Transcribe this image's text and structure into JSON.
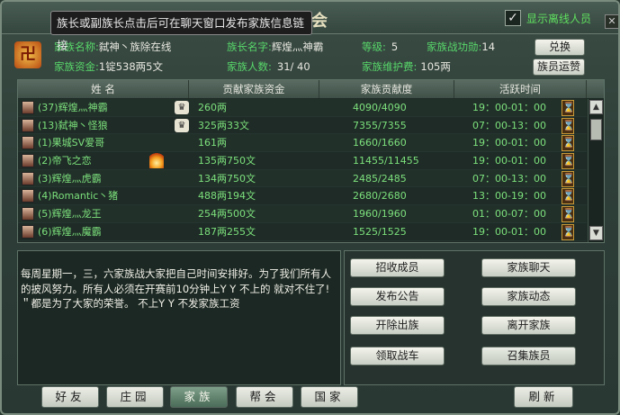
{
  "window": {
    "title": "家族会",
    "tooltip": "族长或副族长点击后可在聊天窗口发布家族信息链接"
  },
  "header": {
    "show_offline_label": "显示离线人员",
    "show_offline_checked": true,
    "close_label": "✕",
    "emblem_glyph": "卍"
  },
  "info": {
    "family_name_label": "家族名称:",
    "family_name_value": "弑神丶族除在线",
    "leader_label": "族长名字:",
    "leader_value": "辉煌灬神霸",
    "level_label": "等级:",
    "level_value": "5",
    "merit_label": "家族战功勋:",
    "merit_value": "14",
    "funds_label": "家族资金:",
    "funds_value": "1锭538两5文",
    "members_label": "家族人数:",
    "members_value": "31/ 40",
    "upkeep_label": "家族维护费:",
    "upkeep_value": "105两",
    "exchange_label": "兑换",
    "transport_label": "族员运赞"
  },
  "table": {
    "headers": [
      "姓     名",
      "贡献家族资金",
      "家族贡献度",
      "活跃时间"
    ],
    "rows": [
      {
        "name": "(37)辉煌灬神霸",
        "funds": "260两",
        "contribution": "4090/4090",
        "active": "19：00-01：00",
        "badge": "crown"
      },
      {
        "name": "(13)弑神丶怪狼",
        "funds": "325两33文",
        "contribution": "7355/7355",
        "active": "07：00-13：00",
        "badge": "crown"
      },
      {
        "name": "(1)果城SV爱哥",
        "funds": "161两",
        "contribution": "1660/1660",
        "active": "19：00-01：00",
        "badge": ""
      },
      {
        "name": "(2)帝飞之恋",
        "funds": "135两750文",
        "contribution": "11455/11455",
        "active": "19：00-01：00",
        "badge": "fire"
      },
      {
        "name": "(3)辉煌灬虎霸",
        "funds": "134两750文",
        "contribution": "2485/2485",
        "active": "07：00-13：00",
        "badge": ""
      },
      {
        "name": "(4)Romantic丶猪",
        "funds": "488两194文",
        "contribution": "2680/2680",
        "active": "13：00-19：00",
        "badge": ""
      },
      {
        "name": "(5)辉煌灬龙王",
        "funds": "254两500文",
        "contribution": "1960/1960",
        "active": "01：00-07：00",
        "badge": ""
      },
      {
        "name": "(6)辉煌灬魔霸",
        "funds": "187两255文",
        "contribution": "1525/1525",
        "active": "19：00-01：00",
        "badge": ""
      }
    ],
    "scroll_up": "▲",
    "scroll_down": "▼",
    "hourglass_glyph": "⌛",
    "crown_glyph": "♛"
  },
  "notice": {
    "text": "每周星期一，三，六家族战大家把自己时间安排好。为了我们所有人的披风努力。所有人必须在开赛前10分钟上Y Y 不上的 就对不住了!＂都是为了大家的荣誉。 不上Y Y 不发家族工资"
  },
  "actions": {
    "recruit": "招收成员",
    "chat": "家族聊天",
    "announce": "发布公告",
    "news": "家族动态",
    "expel": "开除出族",
    "leave": "离开家族",
    "chariot": "领取战车",
    "summon": "召集族员"
  },
  "tabs": {
    "friends": "好友",
    "manor": "庄园",
    "family": "家族",
    "guild": "帮会",
    "nation": "国家",
    "refresh": "刷新"
  }
}
